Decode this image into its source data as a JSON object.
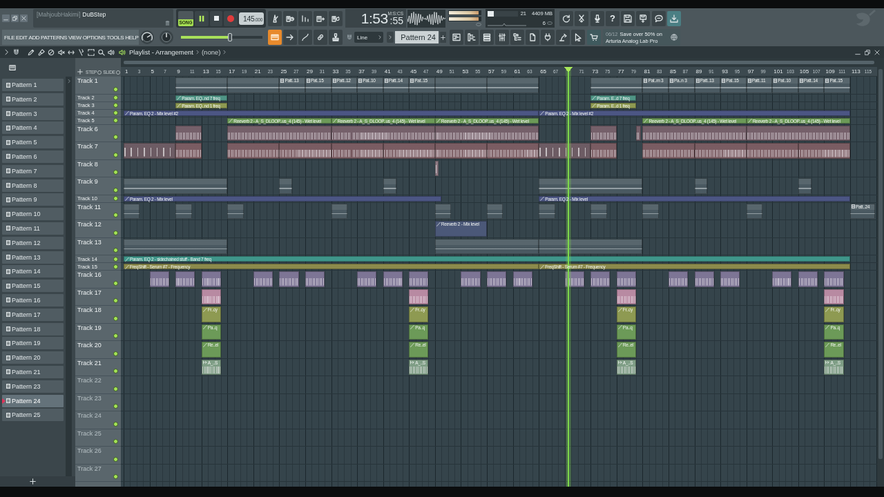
{
  "window": {
    "author": "[MahjoubHakimi]",
    "title": "DuBStep"
  },
  "transport": {
    "song_mode": {
      "label": "SONG",
      "on": true
    },
    "playing": true,
    "tempo": "145",
    "tempo_decimals": ".000"
  },
  "time": {
    "main": "1:53",
    "sub": ":55",
    "unit": "M:S:CS"
  },
  "master_meter": [
    {
      "level": 0.93
    },
    {
      "level": 0.93
    }
  ],
  "cpu": {
    "value": "21",
    "level": 0.21,
    "memory": "4409 MB",
    "polyphony": "6"
  },
  "toolbar": {
    "help": "?"
  },
  "menu": [
    "FILE",
    "EDIT",
    "ADD",
    "PATTERNS",
    "VIEW",
    "OPTIONS",
    "TOOLS",
    "HELP"
  ],
  "song_position": {
    "level": 0.6
  },
  "tool_buttons": [
    {
      "on": true
    },
    {
      "on": false
    },
    {
      "on": false
    },
    {
      "on": false
    },
    {
      "on": false
    }
  ],
  "snap": {
    "value": "Line"
  },
  "pattern_selector": {
    "value": "Pattern 24"
  },
  "news": {
    "date": "06/12",
    "lines": [
      "Save over 50% on",
      "Arturia Analog Lab Pro"
    ]
  },
  "playlist": {
    "title": "Playlist - Arrangement",
    "target": "(none)",
    "step_label": "STEP",
    "slide_label": "SLIDE",
    "ruler": [
      "1",
      "3",
      "5",
      "7",
      "9",
      "11",
      "13",
      "15",
      "17",
      "19",
      "21",
      "23",
      "25",
      "27",
      "29",
      "31",
      "33",
      "35",
      "37",
      "39",
      "41",
      "43",
      "45",
      "47",
      "49",
      "51",
      "53",
      "55",
      "57",
      "59",
      "61",
      "63",
      "65",
      "67",
      "71",
      "73",
      "75",
      "77",
      "79",
      "81",
      "83",
      "85",
      "87",
      "89",
      "91",
      "93",
      "95",
      "97",
      "99",
      "101",
      "103",
      "105",
      "107",
      "109",
      "111",
      "113",
      "115"
    ]
  },
  "patterns": [
    {
      "name": "Pattern 1",
      "selected": false
    },
    {
      "name": "Pattern 2",
      "selected": false
    },
    {
      "name": "Pattern 3",
      "selected": false
    },
    {
      "name": "Pattern 4",
      "selected": false
    },
    {
      "name": "Pattern 5",
      "selected": false
    },
    {
      "name": "Pattern 6",
      "selected": false
    },
    {
      "name": "Pattern 7",
      "selected": false
    },
    {
      "name": "Pattern 8",
      "selected": false
    },
    {
      "name": "Pattern 9",
      "selected": false
    },
    {
      "name": "Pattern 10",
      "selected": false
    },
    {
      "name": "Pattern 11",
      "selected": false
    },
    {
      "name": "Pattern 12",
      "selected": false
    },
    {
      "name": "Pattern 13",
      "selected": false
    },
    {
      "name": "Pattern 14",
      "selected": false
    },
    {
      "name": "Pattern 15",
      "selected": false
    },
    {
      "name": "Pattern 16",
      "selected": false
    },
    {
      "name": "Pattern 17",
      "selected": false
    },
    {
      "name": "Pattern 18",
      "selected": false
    },
    {
      "name": "Pattern 19",
      "selected": false
    },
    {
      "name": "Pattern 20",
      "selected": false
    },
    {
      "name": "Pattern 21",
      "selected": false
    },
    {
      "name": "Pattern 23",
      "selected": false
    },
    {
      "name": "Pattern 24",
      "selected": true
    },
    {
      "name": "Pattern 25",
      "selected": false
    }
  ],
  "tracks": [
    {
      "name": "Track 1",
      "empty": false,
      "enabled": true,
      "clips": [
        {
          "kind": "pattern",
          "color": "#4a5961"
        },
        {
          "kind": "pattern",
          "color": "#4a5961"
        },
        {
          "kind": "pattern",
          "label": "Patt..13",
          "color": "#4a5961"
        },
        {
          "kind": "pattern",
          "label": "Pat..15",
          "color": "#4a5961"
        },
        {
          "kind": "pattern",
          "label": "Patt..12",
          "color": "#4a5961"
        },
        {
          "kind": "pattern",
          "label": "Pat..10",
          "color": "#4a5961"
        },
        {
          "kind": "pattern",
          "label": "Patt..14",
          "color": "#4a5961"
        },
        {
          "kind": "pattern",
          "label": "Pat..15",
          "color": "#4a5961"
        },
        {
          "kind": "pattern",
          "color": "#4a5961"
        },
        {
          "kind": "pattern",
          "color": "#4a5961"
        },
        {
          "kind": "pattern",
          "color": "#4a5961"
        },
        {
          "kind": "pattern",
          "label": "Pat..rn 3",
          "color": "#4a5961"
        },
        {
          "kind": "pattern",
          "label": "Pa..n 3",
          "color": "#4a5961"
        },
        {
          "kind": "pattern",
          "label": "Patt..13",
          "color": "#4a5961"
        },
        {
          "kind": "pattern",
          "label": "Pat..15",
          "color": "#4a5961"
        },
        {
          "kind": "pattern",
          "label": "Patt..11",
          "color": "#4a5961"
        },
        {
          "kind": "pattern",
          "label": "Pat..10",
          "color": "#4a5961"
        },
        {
          "kind": "pattern",
          "label": "Patt..14",
          "color": "#4a5961"
        },
        {
          "kind": "pattern",
          "label": "Pat..15",
          "color": "#4a5961"
        }
      ]
    },
    {
      "name": "Track 2",
      "empty": false,
      "enabled": true,
      "clips": [
        {
          "kind": "automation",
          "label": "Param. EQ..nd 7 freq",
          "color": "#4f9485"
        },
        {
          "kind": "automation",
          "label": "Param. E..d 7 freq",
          "color": "#4f9485"
        }
      ]
    },
    {
      "name": "Track 3",
      "empty": false,
      "enabled": true,
      "clips": [
        {
          "kind": "automation",
          "label": "Param. EQ..nd 1 freq",
          "color": "#8e9a52"
        },
        {
          "kind": "automation",
          "label": "Param. E..d 1 freq",
          "color": "#8e9a52"
        }
      ]
    },
    {
      "name": "Track 4",
      "empty": false,
      "enabled": true,
      "clips": [
        {
          "kind": "automation",
          "label": "Param. EQ 2 - Mix level #2",
          "color": "#4c5684"
        },
        {
          "kind": "automation",
          "label": "Param. EQ 2 - Mix level #2",
          "color": "#4c5684"
        }
      ]
    },
    {
      "name": "Track 5",
      "empty": false,
      "enabled": true,
      "clips": [
        {
          "kind": "automation",
          "label": "Reeverb 2 - A_S_DLOOP..us_4 (145) - Wet level",
          "color": "#6c9a58"
        },
        {
          "kind": "automation",
          "label": "Reeverb 2 - A_S_DLOOP..us_4 (145) - Wet level",
          "color": "#6c9a58"
        },
        {
          "kind": "automation",
          "label": "Reeverb 2 - A_S_DLOOP..us_4 (145) - Wet level",
          "color": "#6c9a58"
        },
        {
          "kind": "automation",
          "label": "Reeverb 2 - A_S_DLOOP..us_4 (145) - Wet level",
          "color": "#6c9a58"
        },
        {
          "kind": "automation",
          "label": "Reeverb 2 - A_S_DLOOP..us_4 (145) - Wet level",
          "color": "#6c9a58"
        }
      ]
    },
    {
      "name": "Track 6",
      "empty": false,
      "enabled": true,
      "clips": [
        {
          "kind": "audio",
          "color": "#75606a"
        },
        {
          "kind": "audio",
          "color": "#75606a"
        },
        {
          "kind": "audio",
          "color": "#75606a"
        },
        {
          "kind": "audio",
          "color": "#75606a"
        },
        {
          "kind": "audio",
          "color": "#75606a"
        },
        {
          "kind": "audio",
          "color": "#75606a"
        },
        {
          "kind": "audio",
          "color": "#75606a"
        },
        {
          "kind": "audio",
          "color": "#75606a"
        }
      ]
    },
    {
      "name": "Track 7",
      "empty": false,
      "enabled": true,
      "clips": [
        {
          "kind": "slices",
          "color": "#6d5c64"
        },
        {
          "kind": "audio",
          "color": "#7a5c62"
        },
        {
          "kind": "audio",
          "color": "#7a5c62"
        },
        {
          "kind": "audio",
          "color": "#7a5c62"
        },
        {
          "kind": "audio",
          "color": "#7a5c62"
        },
        {
          "kind": "audio",
          "color": "#7a5c62"
        },
        {
          "kind": "audio",
          "color": "#7a5c62"
        },
        {
          "kind": "audio",
          "color": "#7a5c62"
        },
        {
          "kind": "slices",
          "color": "#6d5c64"
        },
        {
          "kind": "audio",
          "color": "#7a5c62"
        },
        {
          "kind": "audio",
          "color": "#7a5c62"
        },
        {
          "kind": "audio",
          "color": "#7a5c62"
        },
        {
          "kind": "audio",
          "color": "#7a5c62"
        },
        {
          "kind": "audio",
          "color": "#7a5c62"
        }
      ]
    },
    {
      "name": "Track 8",
      "empty": false,
      "enabled": true,
      "clips": [
        {
          "kind": "slices",
          "color": "#8d7a84"
        }
      ]
    },
    {
      "name": "Track 9",
      "empty": false,
      "enabled": true,
      "clips": [
        {
          "kind": "pattern",
          "color": "#4a5961"
        },
        {
          "kind": "pattern",
          "color": "#4a5961"
        },
        {
          "kind": "pattern",
          "color": "#4a5961"
        },
        {
          "kind": "pattern",
          "color": "#4a5961"
        },
        {
          "kind": "pattern",
          "color": "#4a5961"
        },
        {
          "kind": "pattern",
          "color": "#4a5961"
        }
      ]
    },
    {
      "name": "Track 10",
      "empty": false,
      "enabled": true,
      "clips": [
        {
          "kind": "automation",
          "label": "Param. EQ 2 - Mix level",
          "color": "#4c5684"
        },
        {
          "kind": "automation",
          "label": "Param. EQ 2 - Mix level",
          "color": "#4c5684"
        }
      ]
    },
    {
      "name": "Track 11",
      "empty": false,
      "enabled": true,
      "clips": [
        {
          "kind": "pattern",
          "color": "#4a5961"
        },
        {
          "kind": "pattern",
          "color": "#4a5961"
        },
        {
          "kind": "pattern",
          "color": "#4a5961"
        },
        {
          "kind": "pattern",
          "color": "#4a5961"
        },
        {
          "kind": "pattern",
          "color": "#4a5961"
        },
        {
          "kind": "pattern",
          "color": "#4a5961"
        },
        {
          "kind": "pattern",
          "color": "#4a5961"
        },
        {
          "kind": "pattern",
          "color": "#4a5961"
        },
        {
          "kind": "pattern",
          "color": "#4a5961"
        },
        {
          "kind": "pattern",
          "color": "#4a5961"
        },
        {
          "kind": "pattern",
          "label": "Patt..24",
          "color": "#4a5961"
        }
      ]
    },
    {
      "name": "Track 12",
      "empty": false,
      "enabled": true,
      "clips": [
        {
          "kind": "automation",
          "label": "Reeverb 2 - Mix level",
          "color": "#4b5878"
        }
      ]
    },
    {
      "name": "Track 13",
      "empty": false,
      "enabled": true,
      "clips": [
        {
          "kind": "pattern",
          "color": "#4a5961"
        },
        {
          "kind": "pattern",
          "color": "#4a5961"
        },
        {
          "kind": "pattern",
          "color": "#4a5961"
        }
      ]
    },
    {
      "name": "Track 14",
      "empty": false,
      "enabled": true,
      "clips": [
        {
          "kind": "automation",
          "label": "Param. EQ 2 - sidechained stuff - Band 7 freq",
          "color": "#3f968a"
        }
      ]
    },
    {
      "name": "Track 15",
      "empty": false,
      "enabled": true,
      "clips": [
        {
          "kind": "automation",
          "label": "FreqShift - Serum #7 - Frequency",
          "color": "#8c8b4c"
        },
        {
          "kind": "automation",
          "label": "FreqShift - Serum #7 - Frequency",
          "color": "#8c8b4c"
        }
      ]
    },
    {
      "name": "Track 16",
      "empty": false,
      "enabled": true,
      "clips": [
        {
          "kind": "audio",
          "color": "#7d7595"
        },
        {
          "kind": "audio",
          "color": "#7d7595"
        },
        {
          "kind": "audio",
          "color": "#7d7595"
        },
        {
          "kind": "audio",
          "color": "#7d7595"
        },
        {
          "kind": "audio",
          "color": "#7d7595"
        },
        {
          "kind": "audio",
          "color": "#7d7595"
        },
        {
          "kind": "audio",
          "color": "#7d7595"
        },
        {
          "kind": "audio",
          "color": "#7d7595"
        },
        {
          "kind": "audio",
          "color": "#7d7595"
        },
        {
          "kind": "audio",
          "color": "#7d7595"
        },
        {
          "kind": "audio",
          "color": "#7d7595"
        },
        {
          "kind": "audio",
          "color": "#7d7595"
        },
        {
          "kind": "audio",
          "color": "#7d7595"
        },
        {
          "kind": "audio",
          "color": "#7d7595"
        },
        {
          "kind": "audio",
          "color": "#7d7595"
        },
        {
          "kind": "audio",
          "color": "#7d7595"
        },
        {
          "kind": "audio",
          "color": "#7d7595"
        },
        {
          "kind": "audio",
          "color": "#7d7595"
        },
        {
          "kind": "audio",
          "color": "#7d7595"
        },
        {
          "kind": "audio",
          "color": "#7d7595"
        },
        {
          "kind": "audio",
          "color": "#7d7595"
        }
      ]
    },
    {
      "name": "Track 17",
      "empty": false,
      "enabled": true,
      "clips": [
        {
          "kind": "audio",
          "color": "#b88aa2"
        },
        {
          "kind": "audio",
          "color": "#b88aa2"
        },
        {
          "kind": "audio",
          "color": "#b88aa2"
        },
        {
          "kind": "audio",
          "color": "#b88aa2"
        }
      ]
    },
    {
      "name": "Track 18",
      "empty": false,
      "enabled": true,
      "clips": [
        {
          "kind": "automation",
          "label": "Fr..cy",
          "color": "#8e9a52"
        },
        {
          "kind": "automation",
          "label": "Fr..cy",
          "color": "#8e9a52"
        },
        {
          "kind": "automation",
          "label": "Fr..cy",
          "color": "#8e9a52"
        },
        {
          "kind": "automation",
          "label": "Fr..cy",
          "color": "#8e9a52"
        }
      ]
    },
    {
      "name": "Track 19",
      "empty": false,
      "enabled": true,
      "clips": [
        {
          "kind": "automation",
          "label": "Pa..q",
          "color": "#6c9a58"
        },
        {
          "kind": "automation",
          "label": "Pa..q",
          "color": "#6c9a58"
        },
        {
          "kind": "automation",
          "label": "Pa..q",
          "color": "#6c9a58"
        },
        {
          "kind": "automation",
          "label": "Pa..q",
          "color": "#6c9a58"
        }
      ]
    },
    {
      "name": "Track 20",
      "empty": false,
      "enabled": true,
      "clips": [
        {
          "kind": "automation",
          "label": "Re..el",
          "color": "#6c9a58"
        },
        {
          "kind": "automation",
          "label": "Re..el",
          "color": "#6c9a58"
        },
        {
          "kind": "automation",
          "label": "Re..el",
          "color": "#6c9a58"
        },
        {
          "kind": "automation",
          "label": "Re..el",
          "color": "#6c9a58"
        }
      ]
    },
    {
      "name": "Track 21",
      "empty": false,
      "enabled": true,
      "clips": [
        {
          "kind": "audio",
          "label": "A_..S",
          "color": "#7f9e86"
        },
        {
          "kind": "audio",
          "label": "A_..S",
          "color": "#7f9e86"
        },
        {
          "kind": "audio",
          "label": "A_..S",
          "color": "#7f9e86"
        },
        {
          "kind": "audio",
          "label": "A_..S",
          "color": "#7f9e86"
        }
      ]
    },
    {
      "name": "Track 22",
      "empty": true,
      "enabled": true
    },
    {
      "name": "Track 23",
      "empty": true,
      "enabled": true
    },
    {
      "name": "Track 24",
      "empty": true,
      "enabled": true
    },
    {
      "name": "Track 25",
      "empty": true,
      "enabled": true
    },
    {
      "name": "Track 26",
      "empty": true,
      "enabled": true
    },
    {
      "name": "Track 27",
      "empty": true,
      "enabled": true
    }
  ]
}
